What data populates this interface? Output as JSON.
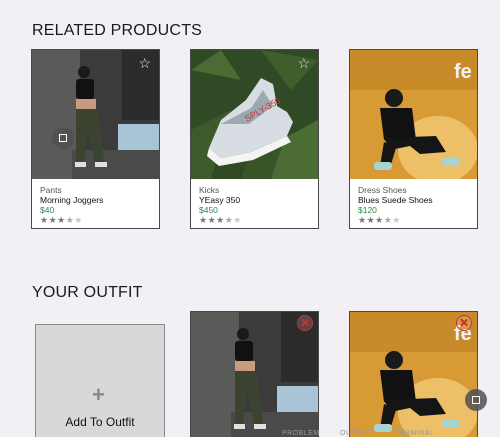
{
  "related": {
    "title": "RELATED PRODUCTS",
    "products": [
      {
        "category": "Pants",
        "name": "Morning Joggers",
        "price": "$40",
        "rating": 3.5
      },
      {
        "category": "Kicks",
        "name": "YEasy 350",
        "price": "$450",
        "rating": 3.5
      },
      {
        "category": "Dress Shoes",
        "name": "Blues Suede Shoes",
        "price": "$120",
        "rating": 3.5
      }
    ]
  },
  "outfit": {
    "title": "YOUR OUTFIT",
    "add_label": "Add To Outfit",
    "plus_glyph": "+"
  },
  "footer": {
    "left": "PROBLEM",
    "mid": "OUTPUT",
    "right": "TERMINAL"
  },
  "icons": {
    "star": "☆",
    "star_full": "★"
  },
  "colors": {
    "price": "#2a8a4a",
    "remove": "#d23030"
  }
}
